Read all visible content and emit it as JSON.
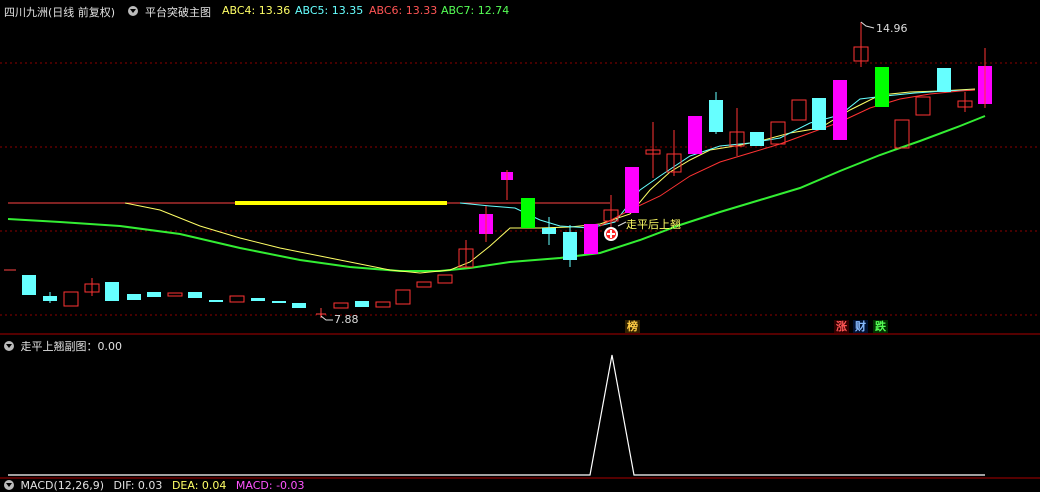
{
  "header": {
    "stock_title": "四川九洲(日线 前复权)",
    "indicator_name": "平台突破主图",
    "abc4_label": "ABC4: 13.36",
    "abc5_label": "ABC5: 13.35",
    "abc6_label": "ABC6: 13.33",
    "abc7_label": "ABC7: 12.74"
  },
  "colors": {
    "abc4": "#ffff66",
    "abc5": "#66ffff",
    "abc6": "#ff4444",
    "abc7": "#44ff44",
    "up": "#ff3333",
    "down": "#66ffff",
    "magenta": "#ff00ff",
    "green_bar": "#00ff00",
    "yellow_line": "#ffff00"
  },
  "main_chart": {
    "high_label": "14.96",
    "low_label": "7.88",
    "signal_label": "走平后上翘",
    "tag_bang": "榜",
    "tag_zhang": "涨",
    "tag_cai": "财",
    "tag_die": "跌"
  },
  "sub_chart": {
    "title": "走平上翘副图：0.00"
  },
  "macd_row": {
    "macd_label": "MACD(12,26,9)",
    "dif_label": "DIF: 0.03",
    "dea_label": "DEA: 0.04",
    "macd_value": "MACD: -0.03"
  }
}
